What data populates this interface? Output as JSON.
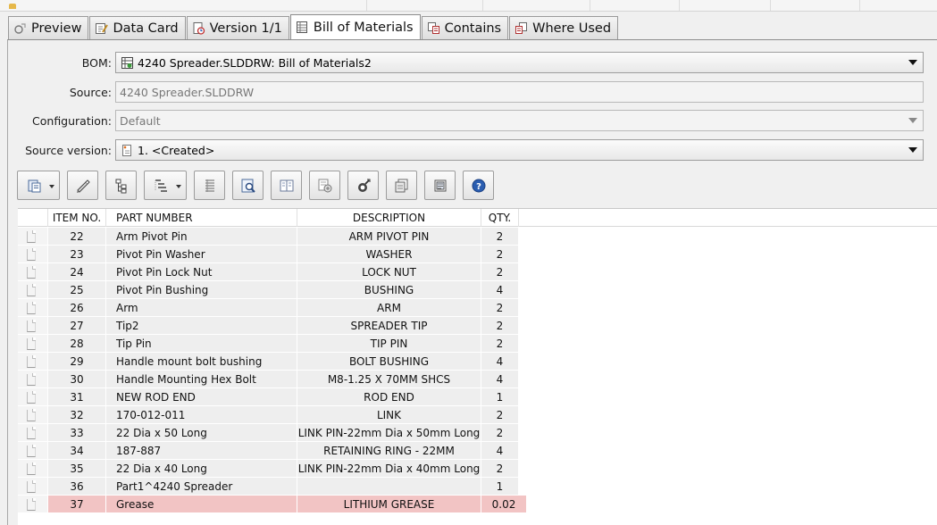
{
  "tabs": [
    {
      "label": "Preview",
      "icon": "preview-icon"
    },
    {
      "label": "Data Card",
      "icon": "data-card-icon"
    },
    {
      "label": "Version 1/1",
      "icon": "version-icon"
    },
    {
      "label": "Bill of Materials",
      "icon": "bom-icon",
      "active": true
    },
    {
      "label": "Contains",
      "icon": "contains-icon"
    },
    {
      "label": "Where Used",
      "icon": "where-used-icon"
    }
  ],
  "form": {
    "bom_label": "BOM:",
    "bom_value": "4240 Spreader.SLDDRW: Bill of Materials2",
    "source_label": "Source:",
    "source_value": "4240 Spreader.SLDDRW",
    "config_label": "Configuration:",
    "config_value": "Default",
    "version_label": "Source version:",
    "version_value": "1. <Created>"
  },
  "toolbar": [
    {
      "name": "export-button",
      "icon": "export-icon"
    },
    {
      "name": "edit-button",
      "icon": "pencil-icon"
    },
    {
      "name": "tree-view-button",
      "icon": "tree-icon"
    },
    {
      "name": "indented-view-button",
      "icon": "indented-list-icon"
    },
    {
      "name": "parts-only-button",
      "icon": "list-icon"
    },
    {
      "name": "find-button",
      "icon": "find-icon"
    },
    {
      "name": "compare-button",
      "icon": "compare-icon"
    },
    {
      "name": "properties-button",
      "icon": "properties-icon"
    },
    {
      "name": "set-version-button",
      "icon": "version-pin-icon"
    },
    {
      "name": "copy-button",
      "icon": "copy-icon"
    },
    {
      "name": "paste-button",
      "icon": "paste-icon"
    },
    {
      "name": "help-button",
      "icon": "help-icon"
    }
  ],
  "table": {
    "headers": {
      "item": "ITEM NO.",
      "part": "PART NUMBER",
      "desc": "DESCRIPTION",
      "qty": "QTY."
    },
    "rows": [
      {
        "item": "22",
        "part": "Arm Pivot Pin",
        "desc": "ARM PIVOT PIN",
        "qty": "2"
      },
      {
        "item": "23",
        "part": "Pivot Pin Washer",
        "desc": "WASHER",
        "qty": "2"
      },
      {
        "item": "24",
        "part": "Pivot Pin Lock Nut",
        "desc": "LOCK NUT",
        "qty": "2"
      },
      {
        "item": "25",
        "part": "Pivot Pin Bushing",
        "desc": "BUSHING",
        "qty": "4"
      },
      {
        "item": "26",
        "part": "Arm",
        "desc": "ARM",
        "qty": "2"
      },
      {
        "item": "27",
        "part": "Tip2",
        "desc": "SPREADER TIP",
        "qty": "2"
      },
      {
        "item": "28",
        "part": "Tip Pin",
        "desc": "TIP PIN",
        "qty": "2"
      },
      {
        "item": "29",
        "part": "Handle mount bolt bushing",
        "desc": "BOLT BUSHING",
        "qty": "4"
      },
      {
        "item": "30",
        "part": "Handle Mounting Hex Bolt",
        "desc": "M8-1.25 X 70MM SHCS",
        "qty": "4"
      },
      {
        "item": "31",
        "part": "NEW ROD END",
        "desc": "ROD END",
        "qty": "1"
      },
      {
        "item": "32",
        "part": "170-012-011",
        "desc": "LINK",
        "qty": "2"
      },
      {
        "item": "33",
        "part": "22 Dia x 50 Long",
        "desc": "LINK PIN-22mm Dia x 50mm Long",
        "qty": "2"
      },
      {
        "item": "34",
        "part": "187-887",
        "desc": "RETAINING RING - 22MM",
        "qty": "4"
      },
      {
        "item": "35",
        "part": "22 Dia x 40 Long",
        "desc": "LINK PIN-22mm Dia x 40mm Long",
        "qty": "2"
      },
      {
        "item": "36",
        "part": "Part1^4240 Spreader",
        "desc": "",
        "qty": "1"
      },
      {
        "item": "37",
        "part": "Grease",
        "desc": "LITHIUM GREASE",
        "qty": "0.02",
        "highlight": true
      }
    ]
  },
  "colors": {
    "highlight_row": "#f2c4c4",
    "row_bg": "#eeeeee",
    "help_blue": "#2a5db0"
  }
}
